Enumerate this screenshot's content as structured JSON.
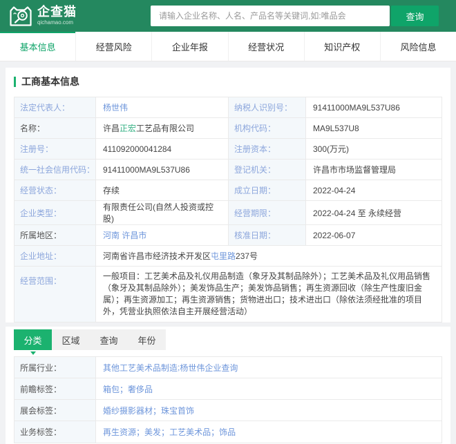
{
  "colors": {
    "header_green": "#24885F",
    "accent_green": "#0FA469",
    "tab_active_green": "#1BB26F",
    "link_blue": "#6E96DB",
    "label_blue": "#8CA6DC",
    "highlight_green": "#35B184"
  },
  "header": {
    "brand_name": "企查猫",
    "brand_domain": "qichamao.com",
    "search_placeholder": "请输入企业名称、人名、产品名等关键词,如:唯品会",
    "search_button": "查询"
  },
  "nav": {
    "tabs": [
      {
        "key": "basic-info",
        "label": "基本信息",
        "active": true
      },
      {
        "key": "business-risk",
        "label": "经营风险",
        "active": false
      },
      {
        "key": "annual-report",
        "label": "企业年报",
        "active": false
      },
      {
        "key": "operation-status",
        "label": "经营状况",
        "active": false
      },
      {
        "key": "intellectual-property",
        "label": "知识产权",
        "active": false
      },
      {
        "key": "risk-info",
        "label": "风险信息",
        "active": false
      }
    ]
  },
  "section_title": "工商基本信息",
  "info_table": {
    "rows": [
      {
        "l1": {
          "t": "法定代表人："
        },
        "v1": [
          {
            "t": "杨世伟",
            "c": "link"
          }
        ],
        "l2": {
          "t": "纳税人识别号："
        },
        "v2": [
          {
            "t": "91411000MA9L537U86"
          }
        ]
      },
      {
        "l1": {
          "t": "名称：",
          "dark": true
        },
        "v1": [
          {
            "t": "许昌"
          },
          {
            "t": "正宏",
            "c": "hl"
          },
          {
            "t": "工艺品有限公司"
          }
        ],
        "l2": {
          "t": "机构代码："
        },
        "v2": [
          {
            "t": "MA9L537U8"
          }
        ]
      },
      {
        "l1": {
          "t": "注册号："
        },
        "v1": [
          {
            "t": "411092000041284"
          }
        ],
        "l2": {
          "t": "注册资本："
        },
        "v2": [
          {
            "t": "300(万元)"
          }
        ]
      },
      {
        "l1": {
          "t": "统一社会信用代码："
        },
        "v1": [
          {
            "t": "91411000MA9L537U86"
          }
        ],
        "l2": {
          "t": "登记机关："
        },
        "v2": [
          {
            "t": "许昌市市场监督管理局"
          }
        ]
      },
      {
        "l1": {
          "t": "经营状态："
        },
        "v1": [
          {
            "t": "存续"
          }
        ],
        "l2": {
          "t": "成立日期："
        },
        "v2": [
          {
            "t": "2022-04-24"
          }
        ]
      },
      {
        "l1": {
          "t": "企业类型："
        },
        "v1": [
          {
            "t": "有限责任公司(自然人投资或控股)"
          }
        ],
        "l2": {
          "t": "经营期限："
        },
        "v2": [
          {
            "t": "2022-04-24 至 永续经营"
          }
        ]
      },
      {
        "l1": {
          "t": "所属地区：",
          "dark": true
        },
        "v1": [
          {
            "t": "河南 许昌市",
            "c": "link"
          }
        ],
        "l2": {
          "t": "核准日期："
        },
        "v2": [
          {
            "t": "2022-06-07"
          }
        ]
      },
      {
        "full": true,
        "l1": {
          "t": "企业地址："
        },
        "v": [
          {
            "t": "河南省许昌市经济技术开发区"
          },
          {
            "t": "屯里路",
            "c": "link"
          },
          {
            "t": "237号"
          }
        ]
      },
      {
        "full": true,
        "tall": true,
        "l1": {
          "t": "经营范围："
        },
        "v": [
          {
            "t": "一般项目：工艺美术品及礼仪用品制造（象牙及其制品除外）；工艺美术品及礼仪用品销售（象牙及其制品除外）；美发饰品生产；美发饰品销售；再生资源回收（除生产性废旧金属）；再生资源加工；再生资源销售；货物进出口；技术进出口（除依法须经批准的项目外，凭营业执照依法自主开展经营活动）"
          }
        ]
      }
    ]
  },
  "filter": {
    "tabs": [
      {
        "key": "category",
        "label": "分类",
        "active": true
      },
      {
        "key": "region",
        "label": "区域",
        "active": false
      },
      {
        "key": "query",
        "label": "查询",
        "active": false
      },
      {
        "key": "year",
        "label": "年份",
        "active": false
      }
    ]
  },
  "tag_table": {
    "rows": [
      {
        "l": {
          "t": "所属行业：",
          "dark": true
        },
        "v": [
          {
            "t": "其他工艺美术品制造",
            "c": "link"
          },
          {
            "t": " ;",
            "c": "sep"
          },
          {
            "t": "杨世伟企业查询",
            "c": "link"
          }
        ]
      },
      {
        "l": {
          "t": "前瞻标签：",
          "dark": true
        },
        "v": [
          {
            "t": "箱包",
            "c": "link"
          },
          {
            "t": "；",
            "c": "sep"
          },
          {
            "t": "奢侈品",
            "c": "link"
          }
        ]
      },
      {
        "l": {
          "t": "展会标签：",
          "dark": true
        },
        "v": [
          {
            "t": "婚纱摄影器材",
            "c": "link"
          },
          {
            "t": "；",
            "c": "sep"
          },
          {
            "t": "珠宝首饰",
            "c": "link"
          }
        ]
      },
      {
        "l": {
          "t": "业务标签：",
          "dark": true
        },
        "v": [
          {
            "t": "再生资源",
            "c": "link"
          },
          {
            "t": "；",
            "c": "sep"
          },
          {
            "t": "美发",
            "c": "link"
          },
          {
            "t": "；",
            "c": "sep"
          },
          {
            "t": "工艺美术品",
            "c": "link"
          },
          {
            "t": "；",
            "c": "sep"
          },
          {
            "t": "饰品",
            "c": "link"
          }
        ]
      }
    ]
  }
}
